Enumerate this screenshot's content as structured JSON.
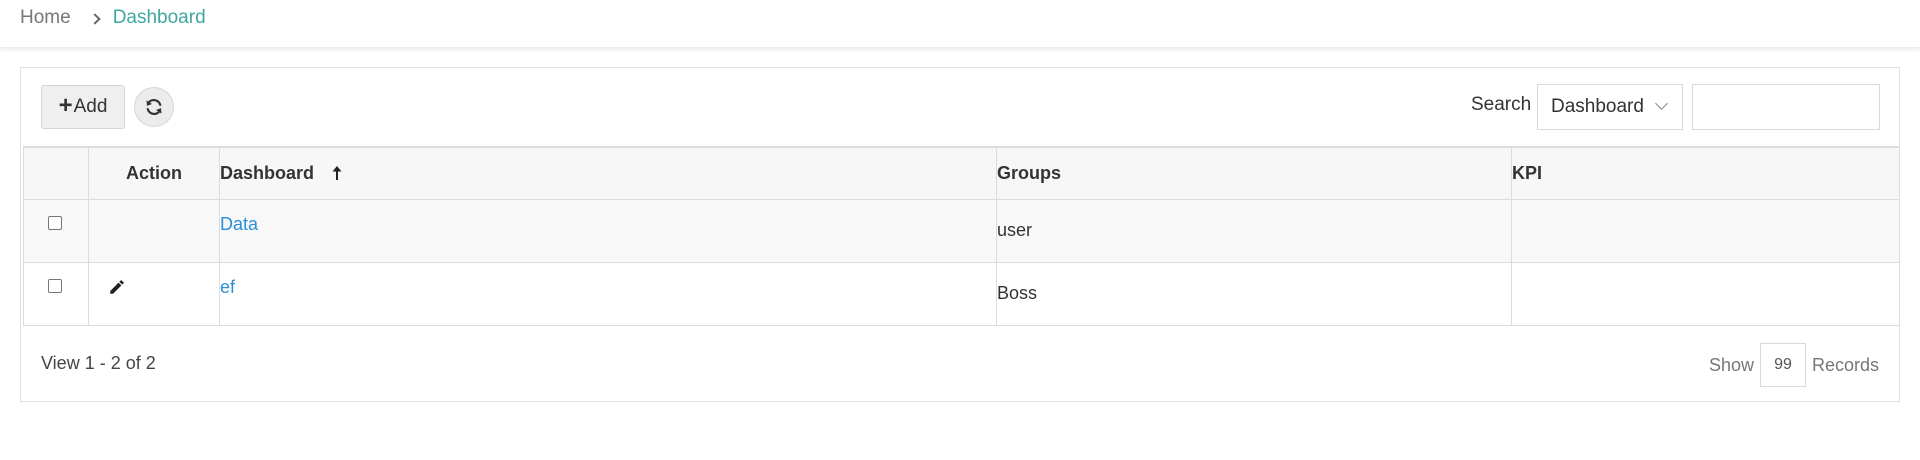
{
  "breadcrumb": {
    "home": "Home",
    "current": "Dashboard"
  },
  "toolbar": {
    "add_label": "Add",
    "search_label": "Search",
    "search_field": "Dashboard",
    "search_value": ""
  },
  "table": {
    "columns": {
      "action": "Action",
      "dashboard": "Dashboard",
      "groups": "Groups",
      "kpi": "KPI"
    },
    "rows": [
      {
        "dashboard": "Data",
        "groups": "user",
        "kpi": "",
        "editable": false
      },
      {
        "dashboard": "ef",
        "groups": "Boss",
        "kpi": "",
        "editable": true
      }
    ]
  },
  "footer": {
    "view_text": "View 1 - 2 of 2",
    "show_label": "Show",
    "records_per_page": "99",
    "records_label": "Records"
  },
  "colors": {
    "accent": "#3fa7a0",
    "link": "#2a8fd6"
  },
  "icons": {
    "separator": "chevron-right-icon",
    "add": "plus-icon",
    "refresh": "refresh-icon",
    "dropdown": "chevron-down-icon",
    "sort": "arrow-up-icon",
    "edit": "pencil-icon"
  }
}
